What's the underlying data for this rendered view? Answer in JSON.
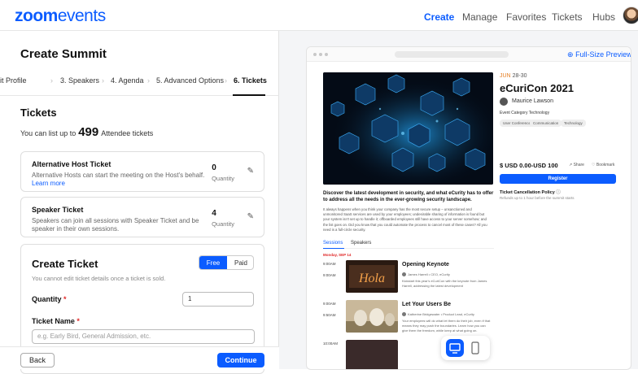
{
  "header": {
    "logo_zoom": "zoom",
    "logo_events": "events",
    "nav": [
      "Create",
      "Manage",
      "Favorites",
      "Tickets",
      "Hubs"
    ],
    "active_nav": "Create"
  },
  "form": {
    "title": "Create Summit",
    "steps": [
      "it Profile",
      "3. Speakers",
      "4. Agenda",
      "5. Advanced Options",
      "6. Tickets"
    ],
    "active_step": "6. Tickets",
    "section_title": "Tickets",
    "list_prefix": "You can list up to",
    "list_count": "499",
    "list_suffix": "Attendee tickets",
    "tickets": [
      {
        "title": "Alternative Host Ticket",
        "desc": "Alternative Hosts can start the meeting on the Host's behalf.",
        "link": "Learn more",
        "quantity": "0",
        "quantity_label": "Quantity"
      },
      {
        "title": "Speaker Ticket",
        "desc": "Speakers can join all sessions with Speaker Ticket and be speaker in their own sessions.",
        "quantity": "4",
        "quantity_label": "Quantity"
      }
    ],
    "create_ticket": {
      "title": "Create Ticket",
      "toggle_free": "Free",
      "toggle_paid": "Paid",
      "note": "You cannot edit ticket details once a ticket is sold.",
      "quantity_label": "Quantity",
      "quantity_value": "1",
      "name_label": "Ticket Name",
      "name_placeholder": "e.g. Early Bird, General Admission, etc.",
      "required_mark": "*"
    },
    "back_label": "Back",
    "continue_label": "Continue"
  },
  "preview": {
    "full_size_label": "Full-Size Preview",
    "date_month": "JUN",
    "date_days": "28-30",
    "event_title": "eCuriCon 2021",
    "host": "Maurice Lawson",
    "category_label": "Event Category",
    "category_value": "Technology",
    "chips": [
      "User Conference",
      "Communication",
      "Technology"
    ],
    "price": "$ USD 0.00-USD 100",
    "share": "Share",
    "bookmark": "Bookmark",
    "register": "Register",
    "cancellation_title": "Ticket Cancellation Policy",
    "cancellation_sub": "Refunds up to 1 hour before the summit starts",
    "desc_heading": "Discover the latest development in security, and what eCurity has to offer to address all the needs in the ever-growing security landscape.",
    "desc_body": "It always happens when you think your company has the most secure setup – unsanctioned and unmonitored SaaS services are used by your employees; undesirable sharing of information is found but your system isn't set up to handle it; offboarded employees still have access to your server somehow; and the list goes on. Did you know that you could automate the process to cancel most of these cases? All you need is a full-circle security.",
    "tabs": [
      "Sessions",
      "Speakers"
    ],
    "day_label": "Monday, SEP 14",
    "sessions": [
      {
        "time_start": "9:00AM",
        "time_end": "9:00AM",
        "title": "Opening Keynote",
        "speaker": "James Harrell • CEO, eCurity",
        "desc": "Kickstart this year's eCuriCon with the keynote from James Harrell, addressing the latest development"
      },
      {
        "time_start": "9:00AM",
        "time_end": "9:50AM",
        "title": "Let Your Users Be",
        "speaker": "Katherine Bridgewater • Product Lead, eCurity",
        "desc": "Your employees will do what let them do their job, even if that means they may push the boundaries. Learn how you can give them the freedom, while keep at what going on."
      }
    ],
    "third_time": "10:00AM"
  }
}
